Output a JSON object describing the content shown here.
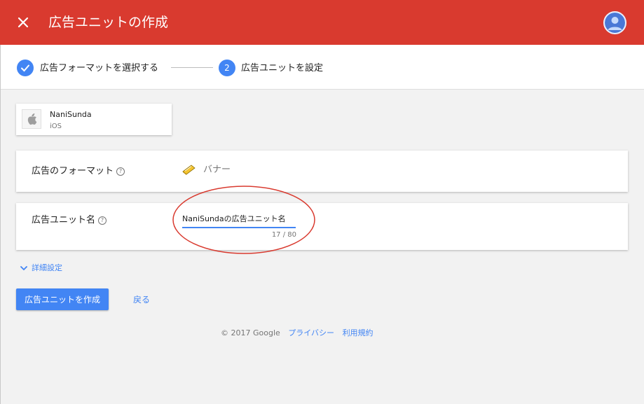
{
  "header": {
    "title": "広告ユニットの作成",
    "close_icon": "close-icon",
    "avatar_icon": "user-avatar-icon",
    "bar_color": "#d93a2f"
  },
  "stepper": {
    "step1": {
      "label": "広告フォーマットを選択する",
      "state": "completed",
      "icon": "check-icon"
    },
    "step2": {
      "number": "2",
      "label": "広告ユニットを設定",
      "state": "active"
    }
  },
  "app_card": {
    "name": "NaniSunda",
    "platform": "iOS",
    "icon": "apple-icon"
  },
  "format_field": {
    "label": "広告のフォーマット",
    "help_icon": "help-icon",
    "value_icon": "banner-icon",
    "value": "バナー"
  },
  "name_field": {
    "label": "広告ユニット名",
    "help_icon": "help-icon",
    "value": "NaniSundaの広告ユニット名",
    "char_count": "17 / 80"
  },
  "advanced": {
    "label": "詳細設定",
    "icon": "chevron-down-icon"
  },
  "actions": {
    "create_label": "広告ユニットを作成",
    "back_label": "戻る"
  },
  "footer": {
    "copyright": "© 2017 Google",
    "privacy": "プライバシー",
    "terms": "利用規約"
  },
  "colors": {
    "accent": "#4285f4",
    "annotation": "#d93a2f"
  }
}
